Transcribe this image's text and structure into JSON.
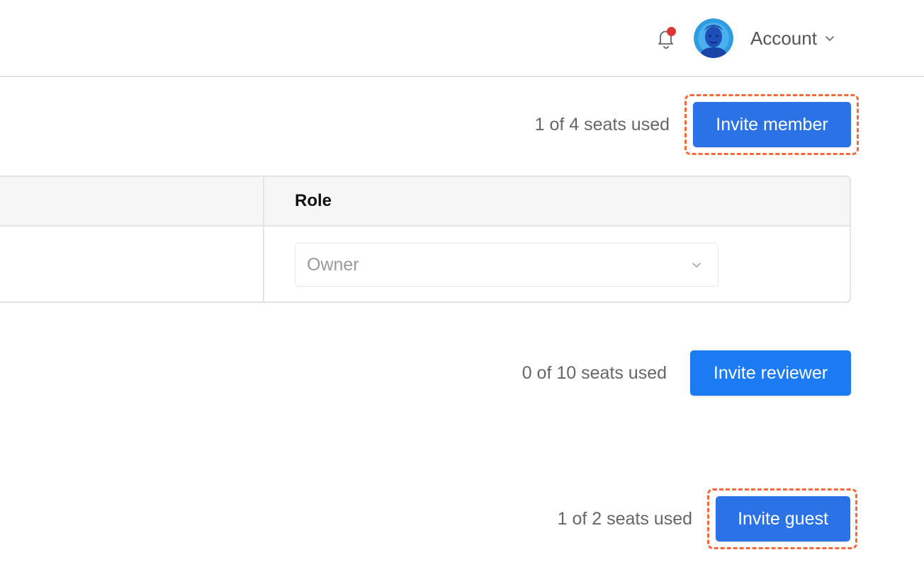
{
  "header": {
    "account_label": "Account",
    "notification_badge_color": "#e03535"
  },
  "members": {
    "seats_text": "1 of 4 seats used",
    "invite_label": "Invite member",
    "table": {
      "columns": [
        "Role"
      ],
      "rows": [
        {
          "role": "Owner"
        }
      ]
    }
  },
  "reviewers": {
    "seats_text": "0 of 10 seats used",
    "invite_label": "Invite reviewer"
  },
  "guests": {
    "seats_text": "1 of 2 seats used",
    "invite_label": "Invite guest"
  },
  "colors": {
    "primary_button": "#2b72e6",
    "highlight_outline": "#f26a3c"
  }
}
